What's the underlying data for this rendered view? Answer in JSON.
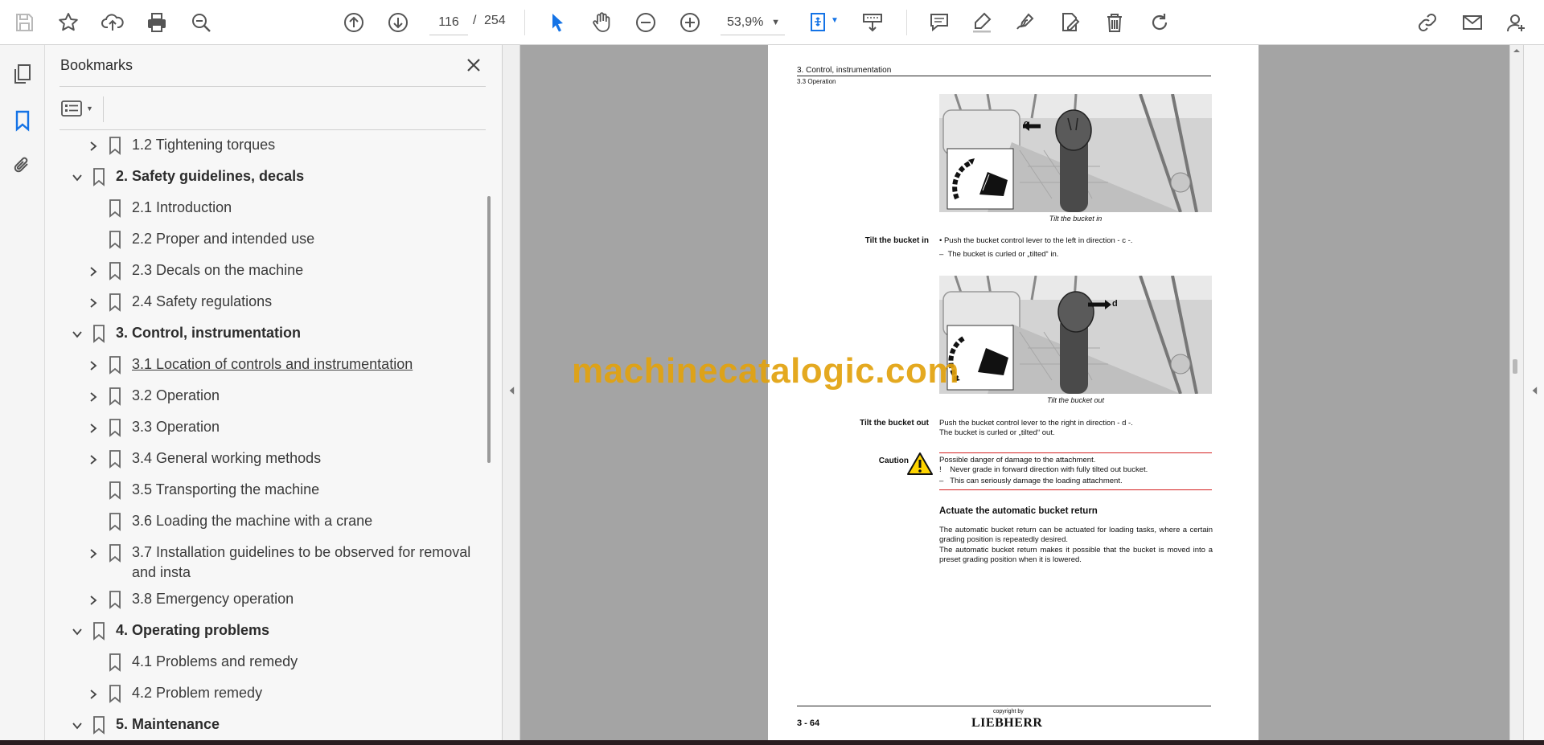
{
  "toolbar": {
    "page_current": "116",
    "page_separator": "/",
    "page_total": "254",
    "zoom": "53,9%",
    "icons": [
      "save-icon",
      "star-icon",
      "upload-icon",
      "print-icon",
      "zoom-search-icon",
      "page-up-icon",
      "page-down-icon",
      "select-cursor-icon",
      "hand-icon",
      "zoom-out-icon",
      "zoom-in-icon",
      "fit-page-icon",
      "scroll-mode-icon",
      "comment-icon",
      "highlight-icon",
      "sign-icon",
      "edit-icon",
      "delete-icon",
      "rotate-icon",
      "share-link-icon",
      "email-icon",
      "account-icon"
    ]
  },
  "rail": {
    "icons": [
      "pages-icon",
      "bookmark-icon",
      "attachment-icon"
    ]
  },
  "bookmarks": {
    "title": "Bookmarks",
    "items": [
      {
        "label": "1.2 Tightening torques",
        "level": 2,
        "chevron": "right",
        "bold": false
      },
      {
        "label": "2. Safety guidelines, decals",
        "level": 1,
        "chevron": "down",
        "bold": true
      },
      {
        "label": "2.1 Introduction",
        "level": 2,
        "chevron": "none",
        "bold": false
      },
      {
        "label": "2.2 Proper and intended use",
        "level": 2,
        "chevron": "none",
        "bold": false
      },
      {
        "label": "2.3 Decals on the machine",
        "level": 2,
        "chevron": "right",
        "bold": false
      },
      {
        "label": "2.4 Safety regulations",
        "level": 2,
        "chevron": "right",
        "bold": false
      },
      {
        "label": "3. Control, instrumentation",
        "level": 1,
        "chevron": "down",
        "bold": true
      },
      {
        "label": "3.1 Location of controls and instrumentation",
        "level": 2,
        "chevron": "right",
        "bold": false,
        "underline": true
      },
      {
        "label": "3.2 Operation",
        "level": 2,
        "chevron": "right",
        "bold": false
      },
      {
        "label": "3.3 Operation",
        "level": 2,
        "chevron": "right",
        "bold": false
      },
      {
        "label": "3.4 General working methods",
        "level": 2,
        "chevron": "right",
        "bold": false
      },
      {
        "label": "3.5 Transporting the machine",
        "level": 2,
        "chevron": "none",
        "bold": false
      },
      {
        "label": "3.6 Loading the machine with a crane",
        "level": 2,
        "chevron": "none",
        "bold": false
      },
      {
        "label": "3.7 Installation guidelines to be observed for removal",
        "label2": "and insta",
        "level": 2,
        "chevron": "right",
        "bold": false
      },
      {
        "label": "3.8 Emergency operation",
        "level": 2,
        "chevron": "right",
        "bold": false
      },
      {
        "label": "4. Operating problems",
        "level": 1,
        "chevron": "down",
        "bold": true
      },
      {
        "label": "4.1 Problems and remedy",
        "level": 2,
        "chevron": "none",
        "bold": false
      },
      {
        "label": "4.2 Problem remedy",
        "level": 2,
        "chevron": "right",
        "bold": false
      },
      {
        "label": "5. Maintenance",
        "level": 1,
        "chevron": "down",
        "bold": true
      }
    ]
  },
  "document": {
    "header_title": "3. Control, instrumentation",
    "header_sub": "3.3 Operation",
    "photo1_letter": "c",
    "photo1_caption": "Tilt the bucket in",
    "tilt_in_head": "Tilt the bucket in",
    "tilt_in_line1": "Push the bucket control lever to the left in direction - c -.",
    "tilt_in_line2": "The bucket is curled or „tilted“ in.",
    "photo2_letter": "d",
    "photo2_caption": "Tilt the bucket out",
    "tilt_out_head": "Tilt the bucket out",
    "tilt_out_line1": "Push the bucket control lever to the right in direction - d -.",
    "tilt_out_line2": "The bucket is curled or „tilted“ out.",
    "caution_head": "Caution",
    "caution_line1": "Possible danger of damage to the attachment.",
    "caution_line2": "Never grade in forward direction with fully tilted out bucket.",
    "caution_line3": "This can seriously damage the loading attachment.",
    "section_title": "Actuate the automatic bucket return",
    "para1": "The automatic bucket return can be actuated for loading tasks, where a certain grading position is repeatedly desired.",
    "para2": "The automatic bucket return makes it possible that the bucket is moved into a preset grading position when it is lowered.",
    "footer_page": "3 - 64",
    "footer_copy": "copyright by",
    "footer_logo": "LIEBHERR"
  },
  "watermark": "machinecatalogic.com",
  "colors": {
    "doc_bg": "#a4a4a4",
    "watermark": "#e2a20e",
    "accent_blue": "#1473e6",
    "caution_red": "#d42020"
  }
}
